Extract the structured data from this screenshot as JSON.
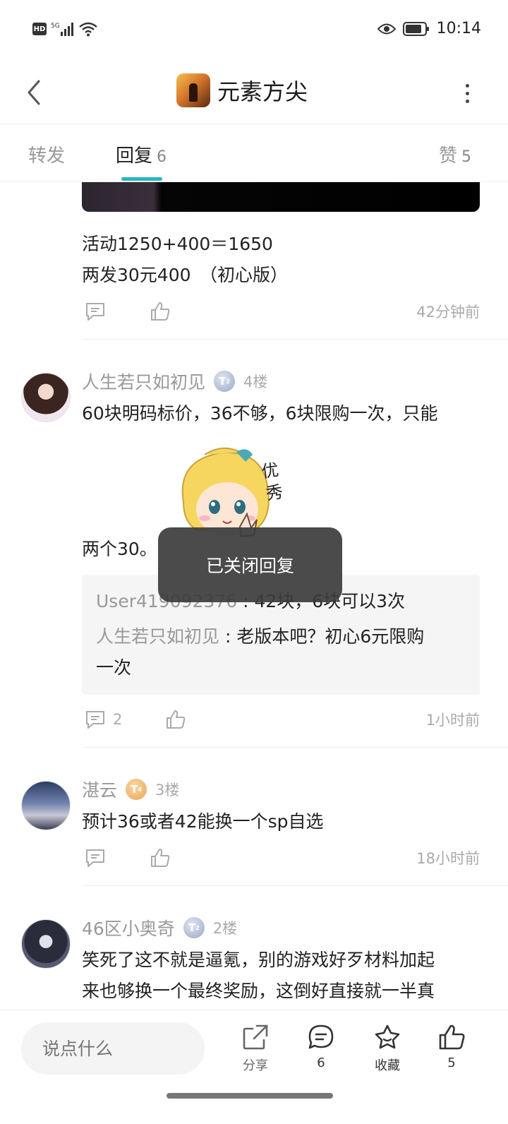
{
  "status_bar": {
    "hd": "HD",
    "network": "5G",
    "time": "10:14"
  },
  "header": {
    "title": "元素方尖",
    "back_icon": "chevron-left-icon",
    "more_icon": "more-vertical-icon"
  },
  "tabs": [
    {
      "label": "转发",
      "count": ""
    },
    {
      "label": "回复",
      "count": "6"
    },
    {
      "label": "赞",
      "count": "5"
    }
  ],
  "accent_color": "#26b5c3",
  "thread": {
    "first_post": {
      "lines": [
        "活动1250+400＝1650",
        "两发30元400　（初心版）"
      ],
      "time": "42分钟前"
    },
    "replies": [
      {
        "user": "人生若只如初见",
        "level": "T",
        "level_sub": "2",
        "floor": "4楼",
        "text_line1": "60块明码标价，36不够，6块限购一次，只能",
        "text_line2": "两个30。",
        "sticker_text": "优秀",
        "sub_replies": [
          {
            "user": "User419092376",
            "text": " : 42块，6块可以3次"
          },
          {
            "user": "人生若只如初见",
            "text": " : 老版本吧？初心6元限购",
            "cont": "一次"
          }
        ],
        "comment_count": "2",
        "time": "1小时前"
      },
      {
        "user": "湛云",
        "level": "T",
        "level_sub": "4",
        "floor": "3楼",
        "text_line1": "预计36或者42能换一个sp自选",
        "time": "18小时前"
      },
      {
        "user": "46区小奥奇",
        "level": "T",
        "level_sub": "2",
        "floor": "2楼",
        "text_line1": "笑死了这不就是逼氪，别的游戏好歹材料加起",
        "text_line2": "来也够换一个最终奖励，这倒好直接就一半真"
      }
    ]
  },
  "toast": "已关闭回复",
  "bottom_bar": {
    "input_placeholder": "说点什么",
    "share_label": "分享",
    "comment_count": "6",
    "favorite_label": "收藏",
    "like_count": "5"
  }
}
